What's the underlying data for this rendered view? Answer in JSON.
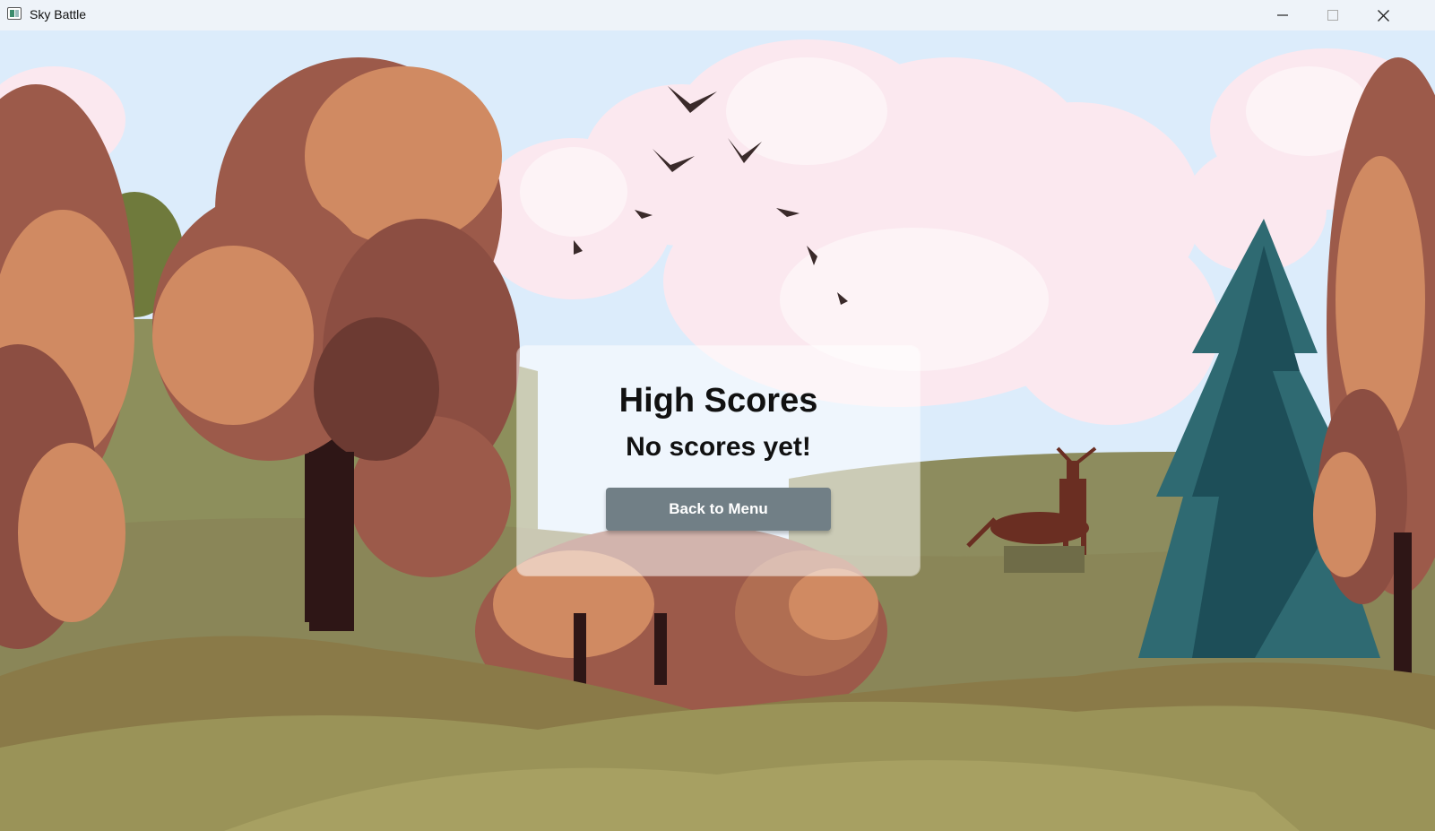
{
  "window": {
    "title": "Sky Battle",
    "controls": [
      "minimize-icon",
      "maximize-icon",
      "close-icon"
    ]
  },
  "scene": {
    "description_icons": [
      "tree",
      "cloud",
      "bird",
      "deer",
      "pine-tree",
      "grass"
    ],
    "colors": {
      "sky": "#dcecfb",
      "cloud": "#fbe8ef",
      "autumn_tree_light": "#d08a62",
      "autumn_tree_mid": "#9c5a4a",
      "autumn_tree_dark": "#6c3a32",
      "trunk": "#2e1616",
      "pine": "#2f6a72",
      "pine_dark": "#1d4e58",
      "grass": "#9a9358",
      "grass_dark": "#7a7244",
      "hill": "#8a8a58",
      "bird": "#3a2a2a",
      "deer": "#6a2e22"
    }
  },
  "high_scores": {
    "title": "High Scores",
    "message": "No scores yet!",
    "back_button_label": "Back to Menu"
  }
}
